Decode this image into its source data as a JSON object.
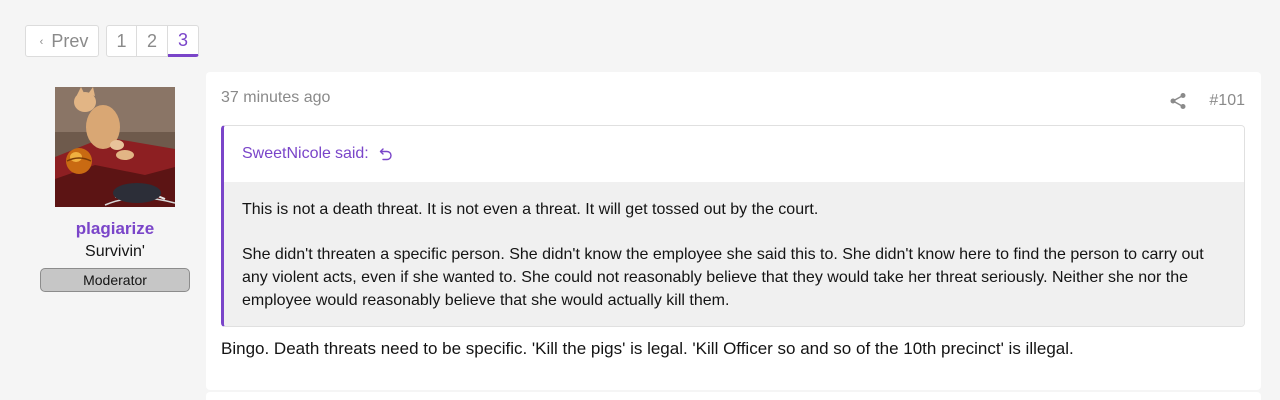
{
  "pagination": {
    "prev_label": "Prev",
    "pages": [
      "1",
      "2",
      "3"
    ],
    "current_page": "3"
  },
  "post": {
    "author": {
      "username": "plagiarize",
      "user_title": "Survivin'",
      "role": "Moderator",
      "avatar_icon": "cat-avatar-image"
    },
    "time": "37 minutes ago",
    "post_number": "#101",
    "quote": {
      "author": "SweetNicole",
      "said_label": "said:",
      "paragraphs": [
        "This is not a death threat. It is not even a threat. It will get tossed out by the court.",
        "She didn't threaten a specific person. She didn't know the employee she said this to. She didn't know here to find the person to carry out any violent acts, even if she wanted to. She could not reasonably believe that they would take her threat seriously. Neither she nor the employee would reasonably believe that she would actually kill them."
      ]
    },
    "body": "Bingo. Death threats need to be specific. 'Kill the pigs' is legal. 'Kill Officer so and so of the 10th precinct' is illegal."
  },
  "colors": {
    "accent": "#7a45c9",
    "muted_text": "#8a8a8a",
    "badge_bg": "#c6c6c6"
  }
}
